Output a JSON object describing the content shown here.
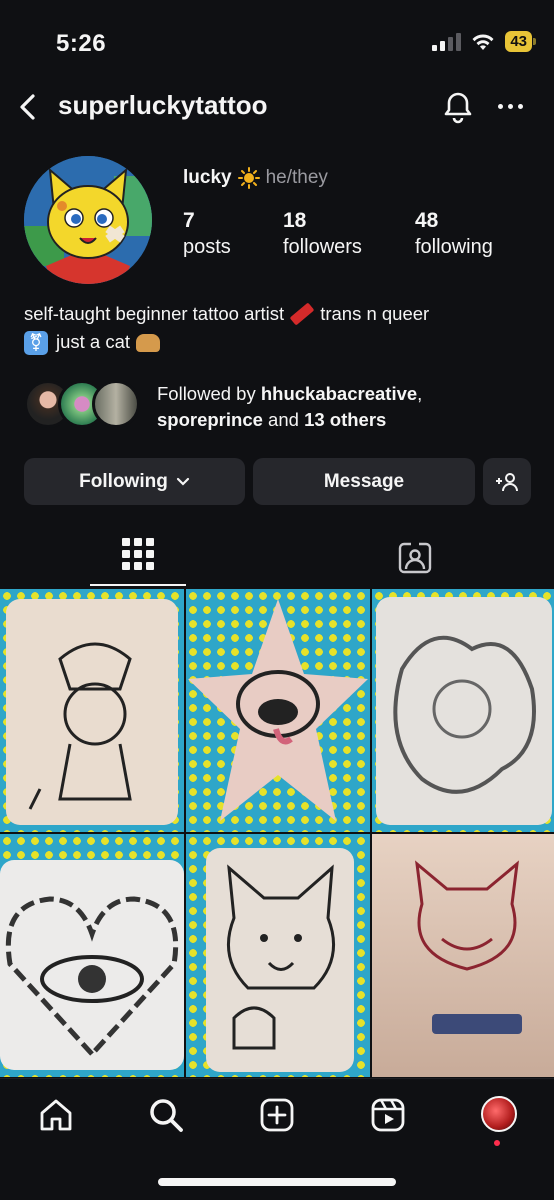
{
  "status": {
    "time": "5:26",
    "battery": "43"
  },
  "header": {
    "username": "superluckytattoo"
  },
  "profile": {
    "name": "lucky",
    "pronouns": "he/they",
    "stats": [
      {
        "value": "7",
        "label": "posts"
      },
      {
        "value": "18",
        "label": "followers"
      },
      {
        "value": "48",
        "label": "following"
      }
    ],
    "bio_line1": "self-taught beginner tattoo artist",
    "bio_line1b": "trans n queer",
    "bio_line2": "just a cat",
    "followed_prefix": "Followed by ",
    "followed_user1": "hhuckabacreative",
    "followed_sep": ",",
    "followed_user2": "sporeprince",
    "followed_and": " and ",
    "followed_others": "13 others"
  },
  "actions": {
    "following": "Following",
    "message": "Message"
  },
  "icons": {
    "back": "chevron-left-icon",
    "bell": "bell-icon",
    "more": "more-icon",
    "grid": "grid-icon",
    "tagged": "tagged-icon",
    "home": "home-icon",
    "search": "search-icon",
    "add": "add-icon",
    "reels": "reels-icon"
  },
  "colors": {
    "background": "#0f1013",
    "button": "#26272c",
    "battery": "#e8c437",
    "tile_blue": "#2ea6c9",
    "tile_yellow": "#e6e22a"
  }
}
